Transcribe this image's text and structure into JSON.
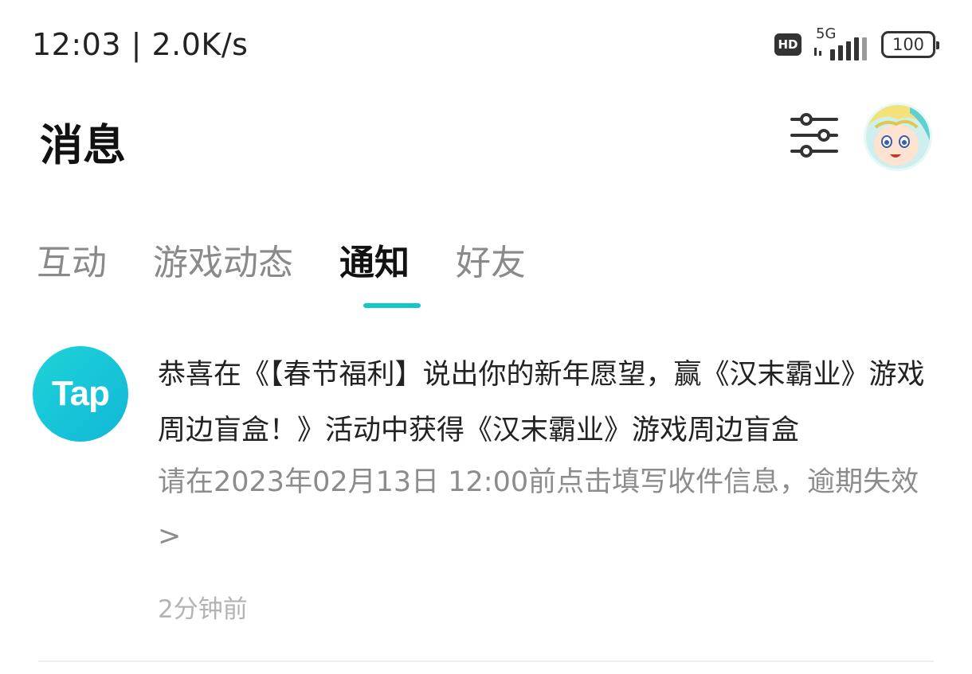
{
  "status_bar": {
    "time_speed": "12:03 | 2.0K/s",
    "hd_badge": "HD",
    "network": "5G",
    "battery": "100",
    "icons": [
      "hd-icon",
      "signal-icon",
      "battery-icon"
    ]
  },
  "header": {
    "title": "消息",
    "filter_icon": "sliders-icon",
    "avatar_icon": "user-avatar"
  },
  "tabs": {
    "items": [
      {
        "label": "互动"
      },
      {
        "label": "游戏动态"
      },
      {
        "label": "通知"
      },
      {
        "label": "好友"
      }
    ],
    "active_index": 2
  },
  "notification": {
    "logo_text": "Tap",
    "title": "恭喜在《【春节福利】说出你的新年愿望，赢《汉末霸业》游戏周边盲盒！》活动中获得《汉末霸业》游戏周边盲盒",
    "description": "请在2023年02月13日 12:00前点击填写收件信息，逾期失效>",
    "time": "2分钟前"
  },
  "colors": {
    "accent": "#15c5ce",
    "logo_gradient_start": "#1fd3d9",
    "logo_gradient_end": "#10b8d6",
    "muted_text": "#8c8c8c"
  }
}
